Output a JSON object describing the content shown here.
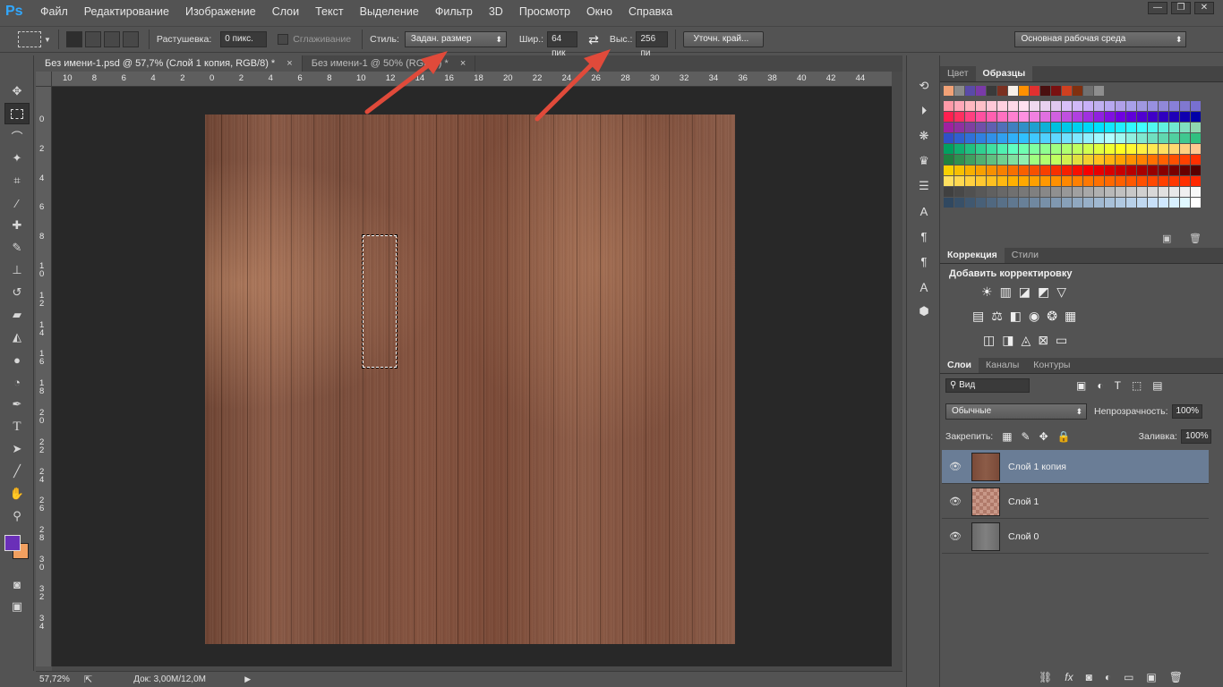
{
  "app": {
    "logo": "Ps"
  },
  "menu": [
    "Файл",
    "Редактирование",
    "Изображение",
    "Слои",
    "Текст",
    "Выделение",
    "Фильтр",
    "3D",
    "Просмотр",
    "Окно",
    "Справка"
  ],
  "window_buttons": [
    "—",
    "❐",
    "✕"
  ],
  "options": {
    "feather_label": "Растушевка:",
    "feather_value": "0 пикс.",
    "antialias_label": "Сглаживание",
    "style_label": "Стиль:",
    "style_value": "Задан. размер",
    "width_label": "Шир.:",
    "width_value": "64 пик",
    "height_label": "Выс.:",
    "height_value": "256 пи",
    "refine_button": "Уточн. край...",
    "workspace_value": "Основная рабочая среда"
  },
  "tabs": [
    {
      "label": "Без имени-1.psd @ 57,7% (Слой 1 копия, RGB/8) *",
      "active": true
    },
    {
      "label": "Без имени-1 @ 50% (RGB/8) *",
      "active": false
    }
  ],
  "tab_close": "×",
  "ruler_top_labels": [
    "10",
    "8",
    "6",
    "4",
    "2",
    "0",
    "2",
    "4",
    "6",
    "8",
    "10",
    "12",
    "14",
    "16",
    "18",
    "20",
    "22",
    "24",
    "26",
    "28",
    "30",
    "32",
    "34",
    "36",
    "38",
    "40",
    "42",
    "44"
  ],
  "ruler_left_labels": [
    "0",
    "2",
    "4",
    "6",
    "8",
    "1\n0",
    "1\n2",
    "1\n4",
    "1\n6",
    "1\n8",
    "2\n0",
    "2\n2",
    "2\n4",
    "2\n6",
    "2\n8",
    "3\n0",
    "3\n2",
    "3\n4"
  ],
  "status": {
    "zoom": "57,72%",
    "doc": "Док: 3,00M/12,0M"
  },
  "panels": {
    "color_tab": "Цвет",
    "swatches_tab": "Образцы",
    "correction_tab": "Коррекция",
    "styles_tab": "Стили",
    "add_adjustment": "Добавить корректировку",
    "layers_tab": "Слои",
    "channels_tab": "Каналы",
    "paths_tab": "Контуры",
    "kind_filter": "Вид",
    "blend_mode": "Обычные",
    "opacity_label": "Непрозрачность:",
    "opacity_value": "100%",
    "lock_label": "Закрепить:",
    "fill_label": "Заливка:",
    "fill_value": "100%"
  },
  "layers": [
    {
      "name": "Слой 1 копия",
      "active": true
    },
    {
      "name": "Слой 1",
      "active": false
    },
    {
      "name": "Слой 0",
      "active": false
    }
  ],
  "swatch_top": [
    "#f2a277",
    "#8a8a8a",
    "#5a4aa8",
    "#7a3aa8",
    "#3a3a3a",
    "#7b3020",
    "#f8f0e8",
    "#ff9000",
    "#e03030",
    "#4a1010",
    "#7a1010",
    "#d04020",
    "#803010",
    "#707070",
    "#8e8e8e"
  ],
  "swatch_grid": [
    [
      "#ff9aa8",
      "#ffa8b8",
      "#ffb8c0",
      "#ffc0c8",
      "#ffc8d8",
      "#ffd0e0",
      "#ffd8e8",
      "#ffe0f0",
      "#f0d8f0",
      "#e8d0f0",
      "#e0c8f0",
      "#d8c0f8",
      "#d0b8f8",
      "#c8b0f8",
      "#c0b0f0",
      "#b8a8f0",
      "#b0a0e8",
      "#a8a0e8",
      "#a098e0",
      "#9890e0",
      "#9088d8",
      "#8880d8",
      "#8078d0",
      "#7870d0"
    ],
    [
      "#ff2050",
      "#ff3060",
      "#ff4080",
      "#ff50a0",
      "#ff60b0",
      "#ff70c0",
      "#ff80d0",
      "#ff90e0",
      "#f080e0",
      "#e070e0",
      "#d060e0",
      "#c050e0",
      "#b040e0",
      "#a030e0",
      "#9020e0",
      "#8010e0",
      "#7000e0",
      "#6000d8",
      "#5000d0",
      "#4000c8",
      "#3000c0",
      "#2000b8",
      "#1000b0",
      "#0000a8"
    ],
    [
      "#a020a0",
      "#9030a0",
      "#8040a0",
      "#7050a8",
      "#6060b0",
      "#5070b8",
      "#4080c0",
      "#3090c8",
      "#20a0d0",
      "#10b0d8",
      "#00c0e0",
      "#00c8e8",
      "#00d0f0",
      "#00d8f8",
      "#00e0ff",
      "#10e8ff",
      "#20f0ff",
      "#30f8ff",
      "#40ffff",
      "#50f8f0",
      "#60f0e0",
      "#70e8d0",
      "#80e0c0",
      "#90d8b0"
    ],
    [
      "#3050c8",
      "#3060d0",
      "#3070d8",
      "#3080e0",
      "#3090e8",
      "#30a0f0",
      "#30b0f8",
      "#30c0ff",
      "#40c8ff",
      "#50d0ff",
      "#60d8ff",
      "#70e0ff",
      "#80e8ff",
      "#90f0ff",
      "#a0f8ff",
      "#b0ffff",
      "#a0f8f0",
      "#90f0e0",
      "#80e8d0",
      "#70e0c0",
      "#60d8b0",
      "#50d0a0",
      "#40c890",
      "#30c080"
    ],
    [
      "#00a060",
      "#10b070",
      "#20c080",
      "#30d090",
      "#40e0a0",
      "#50f0b0",
      "#60ffc0",
      "#70ffb0",
      "#80ffa0",
      "#90ff90",
      "#a0ff80",
      "#b0ff70",
      "#c0ff60",
      "#d0ff50",
      "#e0ff40",
      "#f0ff30",
      "#ffff20",
      "#fff830",
      "#fff040",
      "#ffe850",
      "#ffe060",
      "#ffd870",
      "#ffd080",
      "#ffc890"
    ],
    [
      "#208040",
      "#309050",
      "#40a060",
      "#50b070",
      "#60c080",
      "#70d090",
      "#80e0a0",
      "#90f0b0",
      "#a0ff80",
      "#b0ff70",
      "#c0ff60",
      "#d0f050",
      "#e0e040",
      "#f0d030",
      "#ffc020",
      "#ffb010",
      "#ffa000",
      "#ff9000",
      "#ff8000",
      "#ff7000",
      "#ff6000",
      "#ff5000",
      "#ff4000",
      "#ff3000"
    ],
    [
      "#f8d000",
      "#f8c000",
      "#f8b000",
      "#f8a000",
      "#f89000",
      "#f88000",
      "#f87000",
      "#f86000",
      "#f85000",
      "#f84000",
      "#f83000",
      "#f82000",
      "#f81000",
      "#f80000",
      "#e80000",
      "#d80000",
      "#c80000",
      "#b80000",
      "#a80000",
      "#980000",
      "#880000",
      "#780000",
      "#680000",
      "#580000"
    ],
    [
      "#ffe060",
      "#ffd850",
      "#ffd040",
      "#ffc830",
      "#ffc020",
      "#ffb810",
      "#ffb000",
      "#ffa800",
      "#ffa000",
      "#ff9800",
      "#ff9000",
      "#ff8800",
      "#ff8000",
      "#ff7800",
      "#ff7000",
      "#ff6800",
      "#ff6000",
      "#ff5800",
      "#ff5000",
      "#ff4800",
      "#ff4000",
      "#ff3800",
      "#ff3000",
      "#ff2800"
    ],
    [
      "#404040",
      "#484848",
      "#505050",
      "#585858",
      "#606060",
      "#686868",
      "#707070",
      "#787878",
      "#808080",
      "#888888",
      "#909090",
      "#989898",
      "#a0a0a0",
      "#a8a8a8",
      "#b0b0b0",
      "#b8b8b8",
      "#c0c0c0",
      "#c8c8c8",
      "#d0d0d0",
      "#d8d8d8",
      "#e0e0e0",
      "#e8e8e8",
      "#f0f0f0",
      "#f8f8f8"
    ],
    [
      "#304860",
      "#385068",
      "#405870",
      "#486078",
      "#506880",
      "#587088",
      "#607890",
      "#688098",
      "#7088a0",
      "#7890a8",
      "#8098b0",
      "#88a0b8",
      "#90a8c0",
      "#98b0c8",
      "#a0b8d0",
      "#a8c0d8",
      "#b0c8e0",
      "#b8d0e8",
      "#c0d8f0",
      "#c8e0f8",
      "#d0e8ff",
      "#d8f0ff",
      "#e0f8ff",
      "#ffffff"
    ]
  ],
  "colors": {
    "foreground": "#6a2fb8",
    "background": "#f2a060",
    "arrow": "#e04a3a",
    "active_layer": "#6a7d96"
  }
}
